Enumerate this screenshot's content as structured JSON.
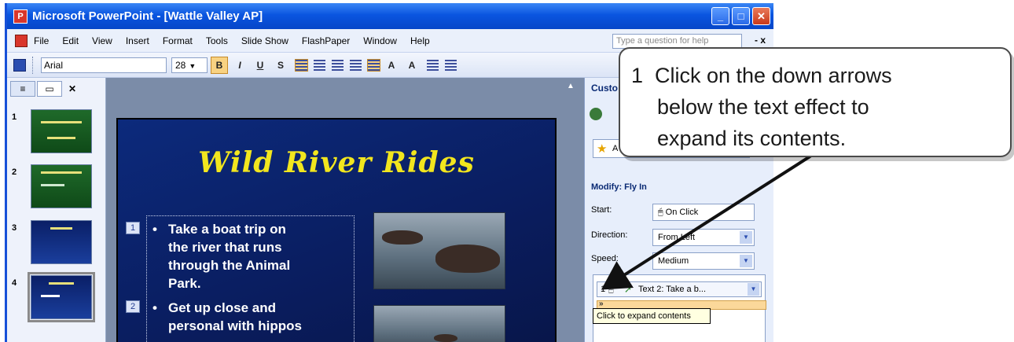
{
  "window": {
    "title": "Microsoft PowerPoint - [Wattle Valley AP]"
  },
  "menu": {
    "items": [
      "File",
      "Edit",
      "View",
      "Insert",
      "Format",
      "Tools",
      "Slide Show",
      "FlashPaper",
      "Window",
      "Help"
    ],
    "help_placeholder": "Type a question for help",
    "close_glyph": "- x"
  },
  "toolbar": {
    "font": "Arial",
    "size": "28"
  },
  "slides_pane": {
    "numbers": [
      "1",
      "2",
      "3",
      "4"
    ],
    "selected": "4"
  },
  "slide": {
    "title": "Wild River Rides",
    "bullets": [
      {
        "tag": "1",
        "lines": [
          "Take a boat trip on",
          "the river that runs",
          "through the Animal",
          "Park."
        ]
      },
      {
        "tag": "2",
        "lines": [
          "Get up close and",
          "personal with hippos"
        ]
      }
    ]
  },
  "task_pane": {
    "title": "Custo",
    "add_effect": "A",
    "modify_label": "Modify: Fly In",
    "start_label": "Start:",
    "start_value": "On Click",
    "direction_label": "Direction:",
    "direction_value": "From Left",
    "speed_label": "Speed:",
    "speed_value": "Medium",
    "list_item_num": "1",
    "list_item_text": "Text 2: Take a b...",
    "tooltip": "Click to expand contents"
  },
  "callout": {
    "number": "1",
    "lines": [
      "Click on the down arrows",
      "below the text effect to",
      "expand its contents."
    ]
  },
  "colors": {
    "title_blue": "#0a55e0",
    "slide_bg": "#0c2a7c",
    "slide_title": "#f2e61e",
    "expand_highlight": "#fbd89a"
  }
}
